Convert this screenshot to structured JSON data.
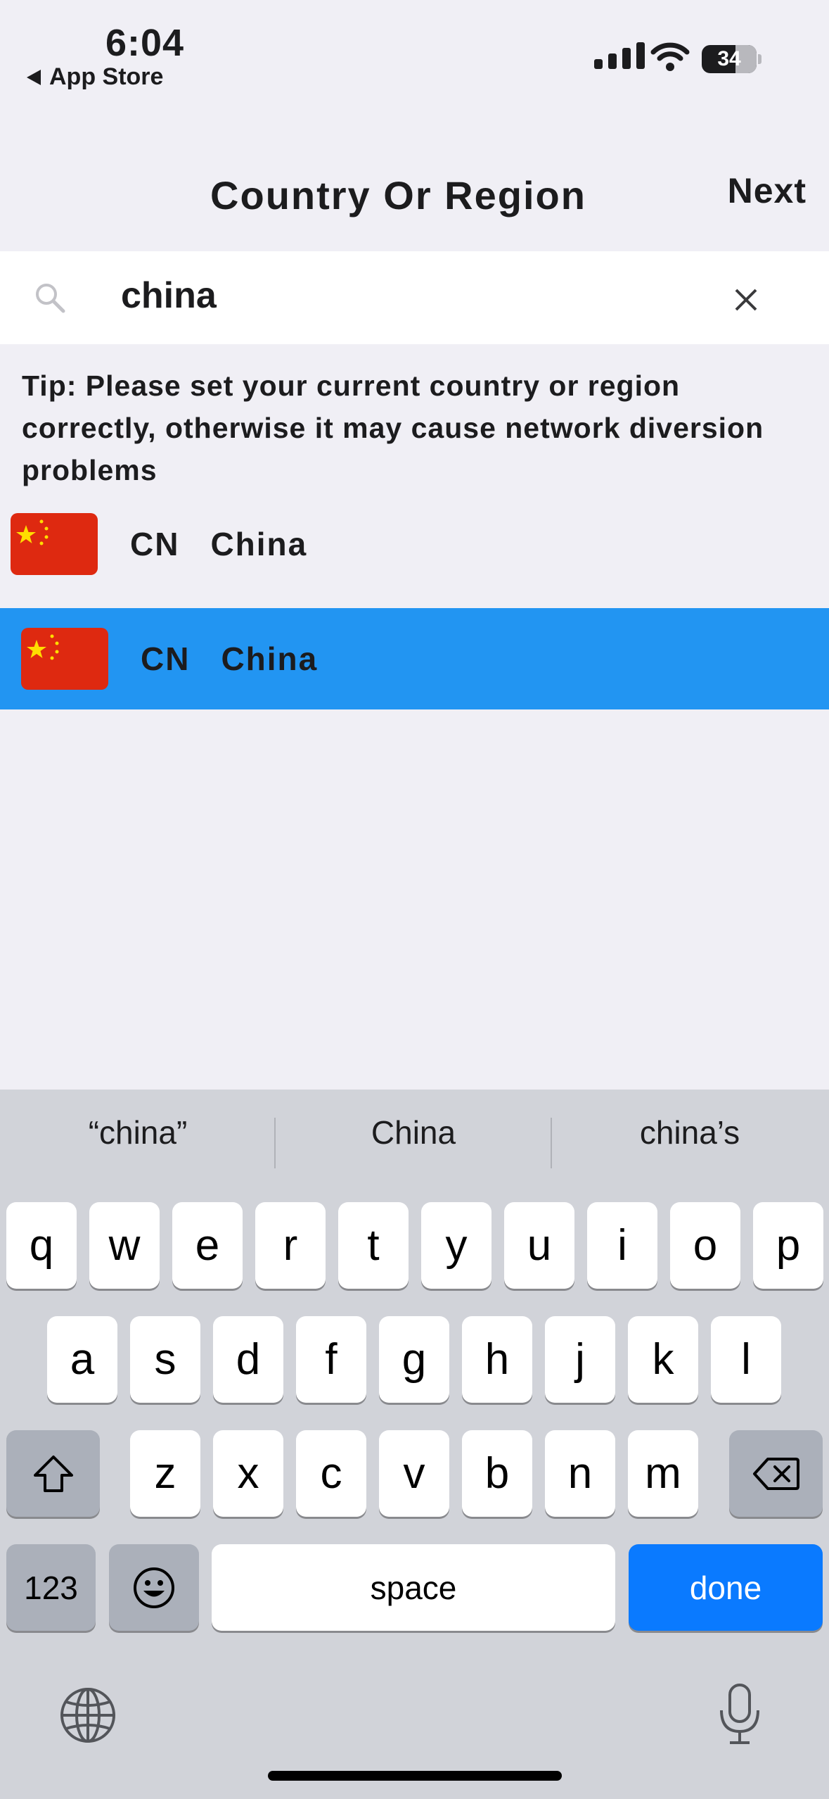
{
  "status": {
    "time": "6:04",
    "back_app": "App Store",
    "battery": "34"
  },
  "header": {
    "title": "Country Or Region",
    "next_label": "Next"
  },
  "search": {
    "value": "china"
  },
  "tip": "Tip: Please set your current country or region correctly, otherwise it may cause network diversion problems",
  "results": [
    {
      "code": "CN",
      "name": "China"
    },
    {
      "code": "CN",
      "name": "China",
      "selected": true
    }
  ],
  "colors": {
    "selected_row": "#2295f2",
    "flag_red": "#de2910",
    "flag_yellow": "#ffde00",
    "done_key": "#0a7aff"
  },
  "keyboard": {
    "suggestions": [
      "“china”",
      "China",
      "china’s"
    ],
    "row1": [
      "q",
      "w",
      "e",
      "r",
      "t",
      "y",
      "u",
      "i",
      "o",
      "p"
    ],
    "row2": [
      "a",
      "s",
      "d",
      "f",
      "g",
      "h",
      "j",
      "k",
      "l"
    ],
    "row3": [
      "z",
      "x",
      "c",
      "v",
      "b",
      "n",
      "m"
    ],
    "numbers_key": "123",
    "space_key": "space",
    "done_key": "done"
  }
}
